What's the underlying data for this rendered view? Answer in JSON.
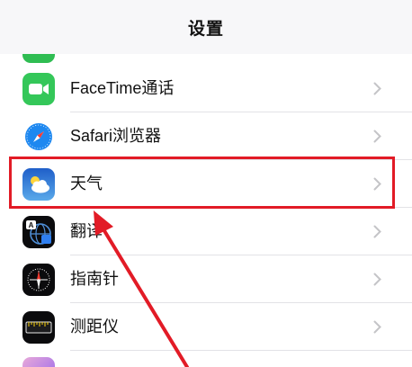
{
  "nav": {
    "title": "设置"
  },
  "rows": [
    {
      "label": "FaceTime通话",
      "icon": "facetime-icon"
    },
    {
      "label": "Safari浏览器",
      "icon": "safari-icon"
    },
    {
      "label": "天气",
      "icon": "weather-icon"
    },
    {
      "label": "翻译",
      "icon": "translate-icon"
    },
    {
      "label": "指南针",
      "icon": "compass-icon"
    },
    {
      "label": "测距仪",
      "icon": "measure-icon"
    }
  ],
  "annotation": {
    "highlight_color": "#e21b26"
  }
}
